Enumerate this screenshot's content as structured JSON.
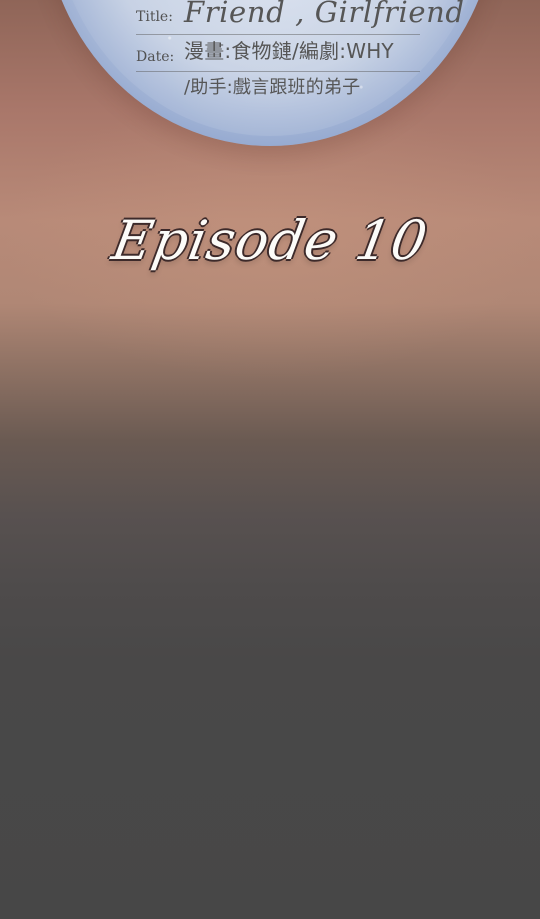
{
  "title_card": {
    "title_label": "Title:",
    "title_value": "Friend , Girlfriend",
    "date_label": "Date:",
    "credit_line_1": "漫畫:食物鏈/編劇:WHY",
    "credit_line_2": "/助手:戲言跟班的弟子"
  },
  "episode": {
    "title": "Episode 10"
  }
}
